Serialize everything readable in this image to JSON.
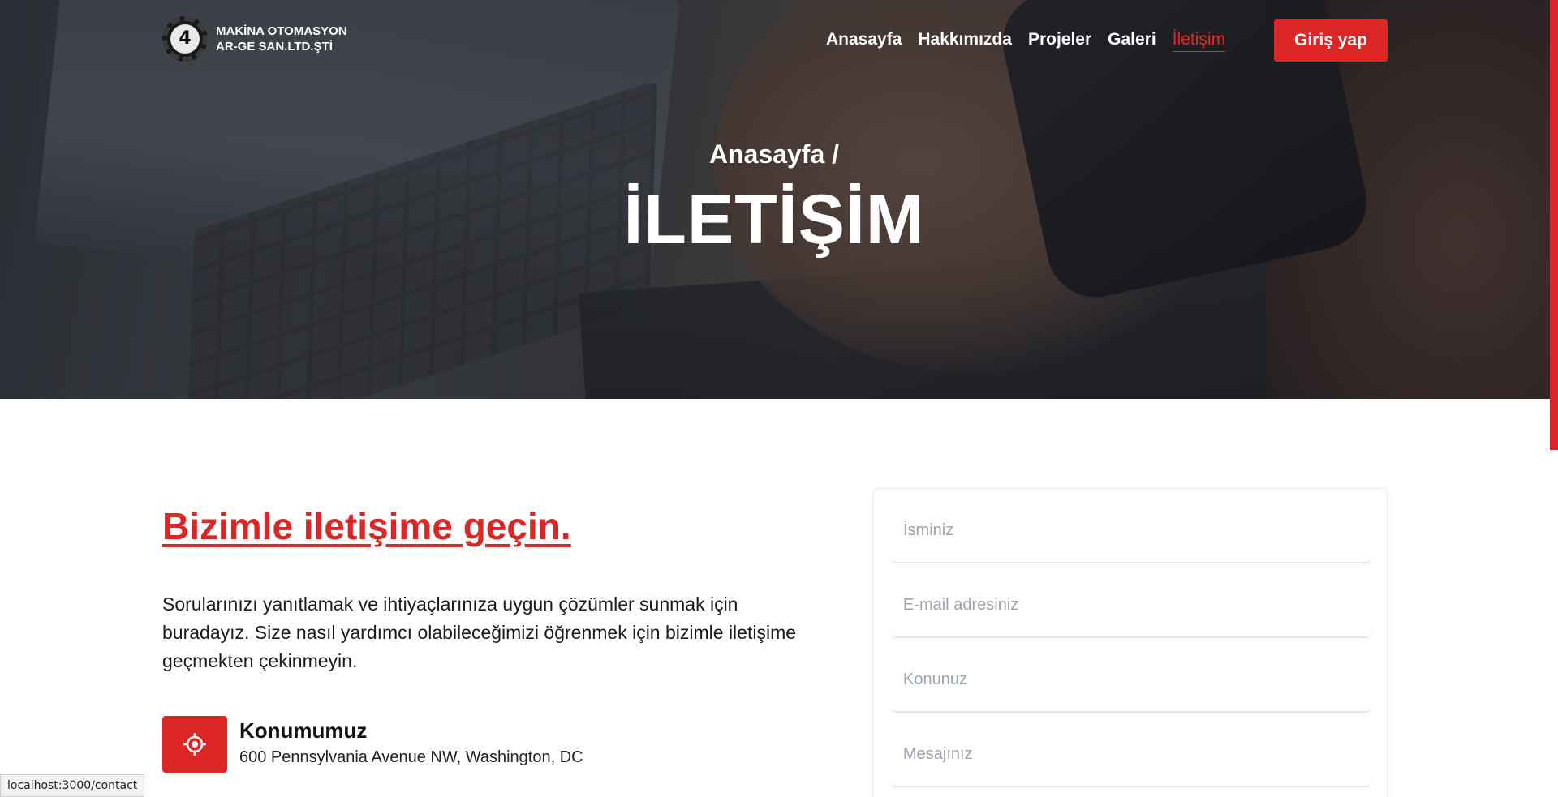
{
  "brand": {
    "mark": "4",
    "line1": "MAKİNA OTOMASYON",
    "line2": "AR-GE SAN.LTD.ŞTİ"
  },
  "nav": {
    "items": [
      {
        "label": "Anasayfa",
        "active": false
      },
      {
        "label": "Hakkımızda",
        "active": false
      },
      {
        "label": "Projeler",
        "active": false
      },
      {
        "label": "Galeri",
        "active": false
      },
      {
        "label": "İletişim",
        "active": true
      }
    ],
    "login_label": "Giriş yap"
  },
  "hero": {
    "breadcrumb": "Anasayfa /",
    "title": "İLETİŞİM"
  },
  "contact": {
    "heading": "Bizimle iletişime geçin.",
    "intro": "Sorularınızı yanıtlamak ve ihtiyaçlarınıza uygun çözümler sunmak için buradayız. Size nasıl yardımcı olabileceğimizi öğrenmek için bizimle iletişime geçmekten çekinmeyin.",
    "location_icon": "location-target-icon",
    "location_title": "Konumumuz",
    "location_address": "600 Pennsylvania Avenue NW, Washington, DC"
  },
  "form": {
    "name_placeholder": "İsminiz",
    "email_placeholder": "E-mail adresiniz",
    "subject_placeholder": "Konunuz",
    "message_placeholder": "Mesajınız"
  },
  "status_url": "localhost:3000/contact",
  "colors": {
    "accent": "#dc2626"
  }
}
